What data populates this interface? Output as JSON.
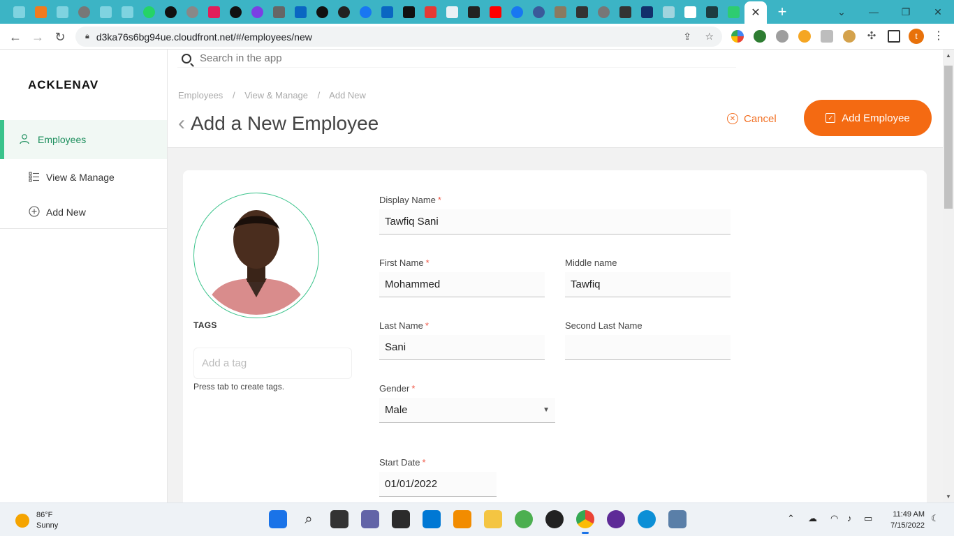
{
  "browser": {
    "url": "d3ka76s6bg94ue.cloudfront.net/#/employees/new",
    "tab_close": "✕",
    "new_tab": "+",
    "profile_initial": "t"
  },
  "app": {
    "logo": "ACKLENAV",
    "search_placeholder": "Search in the app"
  },
  "sidebar": {
    "items": [
      {
        "label": "Employees",
        "icon": "person-icon",
        "active": true
      },
      {
        "label": "View & Manage",
        "icon": "list-icon",
        "active": false
      },
      {
        "label": "Add New",
        "icon": "plus-circle-icon",
        "active": false
      }
    ]
  },
  "header": {
    "breadcrumb": [
      "Employees",
      "View & Manage",
      "Add New"
    ],
    "breadcrumb_sep": "/",
    "title": "Add a New Employee",
    "cancel_label": "Cancel",
    "add_label": "Add Employee"
  },
  "form": {
    "tags_label": "TAGS",
    "tag_placeholder": "Add a tag",
    "tag_hint": "Press tab to create tags.",
    "display_name": {
      "label": "Display Name",
      "value": "Tawfiq Sani",
      "required": true
    },
    "first_name": {
      "label": "First Name",
      "value": "Mohammed",
      "required": true
    },
    "middle_name": {
      "label": "Middle name",
      "value": "Tawfiq",
      "required": false
    },
    "last_name": {
      "label": "Last Name",
      "value": "Sani",
      "required": true
    },
    "second_last_name": {
      "label": "Second Last Name",
      "value": "",
      "required": false
    },
    "gender": {
      "label": "Gender",
      "value": "Male",
      "required": true
    },
    "start_date": {
      "label": "Start Date",
      "value": "01/01/2022",
      "required": true
    },
    "required_mark": "*"
  },
  "taskbar": {
    "temperature": "86°F",
    "condition": "Sunny",
    "time": "11:49 AM",
    "date": "7/15/2022"
  },
  "colors": {
    "accent_green": "#3ac38b",
    "accent_orange": "#f46a12",
    "tab_strip": "#3cb4c5"
  }
}
